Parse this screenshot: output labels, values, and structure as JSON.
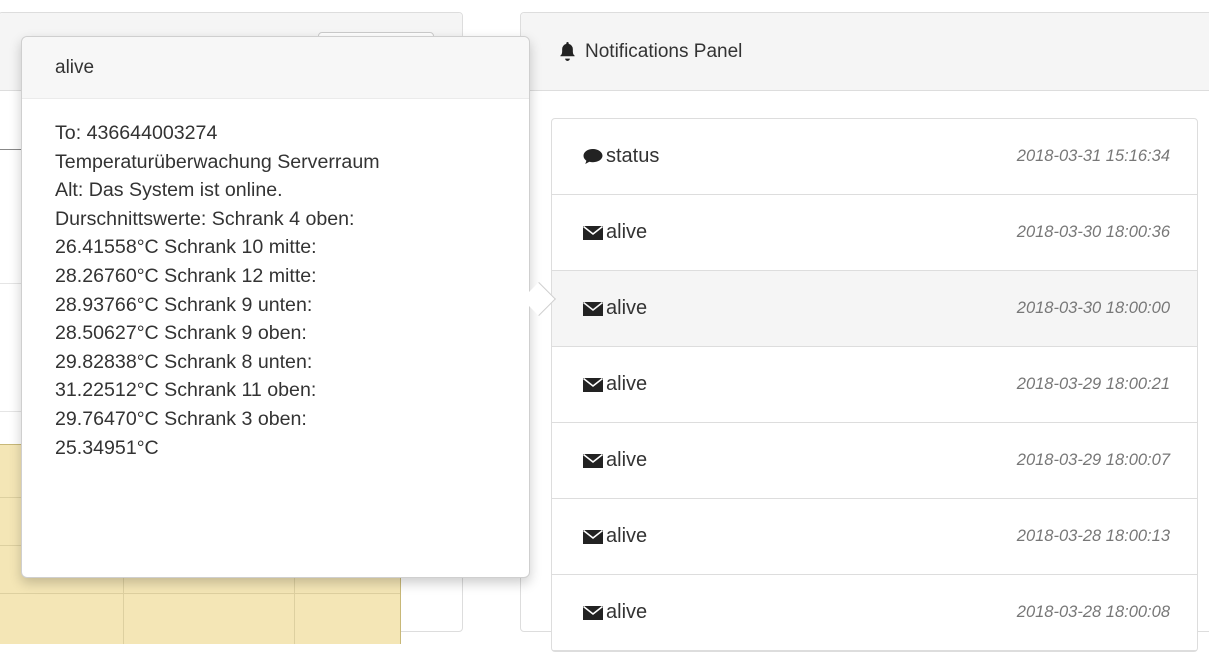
{
  "notifications_panel": {
    "title": "Notifications Panel",
    "items": [
      {
        "icon": "comment-icon",
        "label": "status",
        "timestamp": "2018-03-31 15:16:34",
        "active": false
      },
      {
        "icon": "envelope-icon",
        "label": "alive",
        "timestamp": "2018-03-30 18:00:36",
        "active": false
      },
      {
        "icon": "envelope-icon",
        "label": "alive",
        "timestamp": "2018-03-30 18:00:00",
        "active": true
      },
      {
        "icon": "envelope-icon",
        "label": "alive",
        "timestamp": "2018-03-29 18:00:21",
        "active": false
      },
      {
        "icon": "envelope-icon",
        "label": "alive",
        "timestamp": "2018-03-29 18:00:07",
        "active": false
      },
      {
        "icon": "envelope-icon",
        "label": "alive",
        "timestamp": "2018-03-28 18:00:13",
        "active": false
      },
      {
        "icon": "envelope-icon",
        "label": "alive",
        "timestamp": "2018-03-28 18:00:08",
        "active": false
      }
    ]
  },
  "popover": {
    "title": "alive",
    "lines": [
      "To: 436644003274",
      "Temperaturüberwachung Serverraum",
      "Alt: Das System ist online.",
      "Durschnittswerte: Schrank 4 oben:",
      "26.41558°C Schrank 10 mitte:",
      "28.26760°C Schrank 12 mitte:",
      "28.93766°C Schrank 9 unten:",
      "28.50627°C Schrank 9 oben:",
      "29.82838°C Schrank 8 unten:",
      "31.22512°C Schrank 11 oben:",
      "29.76470°C Schrank 3 oben:",
      "25.34951°C"
    ]
  },
  "colors": {
    "chart_fill": "#f4e6b6",
    "active_row": "#f5f5f5",
    "timestamp": "#777777"
  }
}
